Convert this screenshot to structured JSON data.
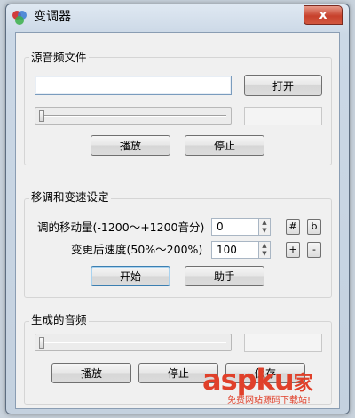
{
  "window": {
    "title": "变调器",
    "close_glyph": "x"
  },
  "source": {
    "group_title": "源音频文件",
    "file_path": "",
    "open_label": "打开",
    "play_label": "播放",
    "stop_label": "停止",
    "position_text": ""
  },
  "settings": {
    "group_title": "移调和变速设定",
    "pitch_label": "调的移动量(-1200～+1200音分)",
    "pitch_value": "0",
    "sharp_label": "#",
    "flat_label": "b",
    "speed_label": "变更后速度(50%～200%)",
    "speed_value": "100",
    "plus_label": "+",
    "minus_label": "-",
    "start_label": "开始",
    "assistant_label": "助手"
  },
  "output": {
    "group_title": "生成的音频",
    "position_text": "",
    "play_label": "播放",
    "stop_label": "停止",
    "save_label": "保存"
  },
  "watermark": {
    "brand": "aspku",
    "suffix": "家",
    "tagline": "免费网站源码下载站!"
  },
  "colors": {
    "accent": "#3c7fb1",
    "watermark": "#e0402a",
    "close_button": "#c7412c"
  }
}
